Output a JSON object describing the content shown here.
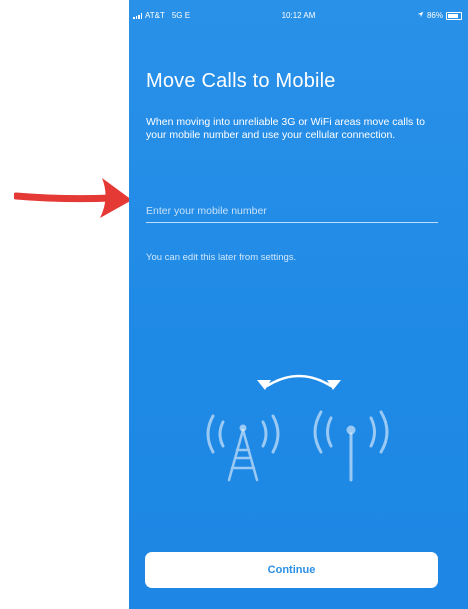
{
  "status_bar": {
    "carrier": "AT&T",
    "network": "5G E",
    "time": "10:12 AM",
    "battery": "86%"
  },
  "screen": {
    "title": "Move Calls to Mobile",
    "description": "When moving into unreliable 3G or WiFi areas move calls to your mobile number and use your cellular connection.",
    "mobile_input": {
      "placeholder": "Enter your mobile number",
      "value": ""
    },
    "hint": "You can edit this later from settings.",
    "continue_label": "Continue"
  },
  "colors": {
    "background": "#1f8ae6",
    "text": "#ffffff",
    "button_text": "#2a8fe6",
    "arrow": "#e53935"
  },
  "icons": [
    "signal-icon",
    "location-arrow-icon",
    "battery-icon",
    "cell-tower-icon",
    "antenna-icon",
    "swap-arrows-icon",
    "red-arrow-icon"
  ]
}
